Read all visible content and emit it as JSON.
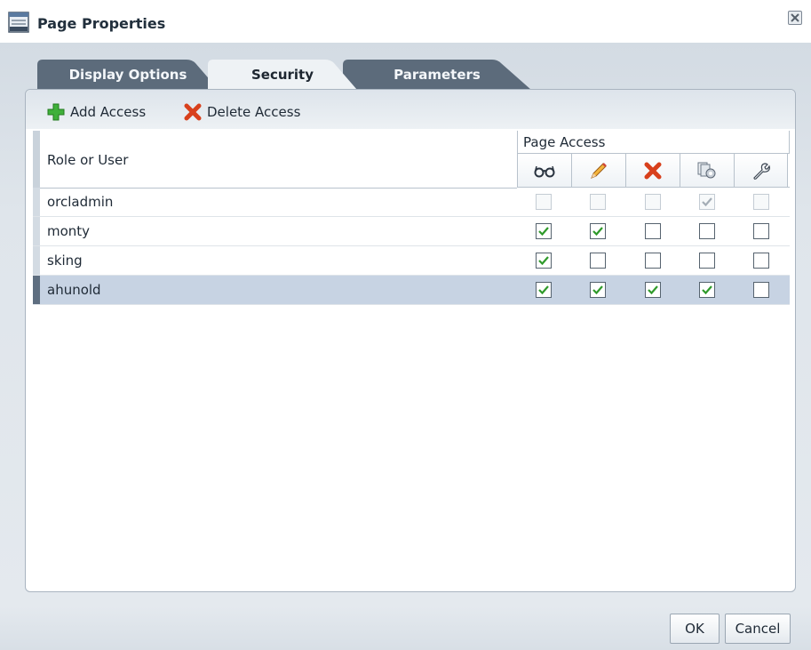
{
  "window": {
    "title": "Page Properties"
  },
  "tabs": [
    {
      "label": "Display Options",
      "active": false
    },
    {
      "label": "Security",
      "active": true
    },
    {
      "label": "Parameters",
      "active": false
    }
  ],
  "toolbar": {
    "add_label": "Add Access",
    "delete_label": "Delete Access"
  },
  "table": {
    "role_header": "Role or User",
    "group_header": "Page Access",
    "permission_icons": [
      "view-glasses-icon",
      "edit-pencil-icon",
      "delete-x-icon",
      "manage-pages-icon",
      "customize-wrench-icon"
    ],
    "rows": [
      {
        "name": "orcladmin",
        "disabled": true,
        "selected": false,
        "permissions": [
          false,
          false,
          false,
          true,
          false
        ]
      },
      {
        "name": "monty",
        "disabled": false,
        "selected": false,
        "permissions": [
          true,
          true,
          false,
          false,
          false
        ]
      },
      {
        "name": "sking",
        "disabled": false,
        "selected": false,
        "permissions": [
          true,
          false,
          false,
          false,
          false
        ]
      },
      {
        "name": "ahunold",
        "disabled": false,
        "selected": true,
        "permissions": [
          true,
          true,
          true,
          true,
          false
        ]
      }
    ]
  },
  "footer": {
    "ok_label": "OK",
    "cancel_label": "Cancel"
  },
  "colors": {
    "check": "#2f9a2a",
    "add_icon": "#3fb03a",
    "delete_icon": "#d8401c",
    "selected_row": "#c7d3e3"
  }
}
